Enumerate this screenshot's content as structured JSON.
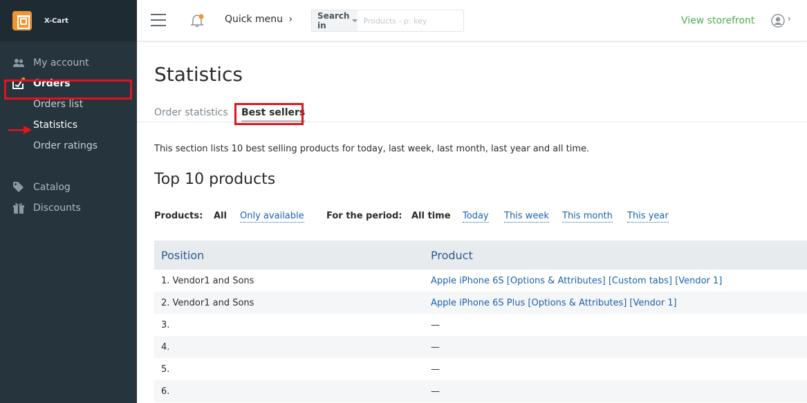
{
  "brand": {
    "name": "X-Cart"
  },
  "sidebar": {
    "items": [
      {
        "label": "My account",
        "icon": "users-icon"
      },
      {
        "label": "Orders",
        "icon": "orders-icon",
        "active": true
      },
      {
        "label": "Catalog",
        "icon": "tag-icon"
      },
      {
        "label": "Discounts",
        "icon": "gift-icon"
      }
    ],
    "orders_sub": [
      {
        "label": "Orders list"
      },
      {
        "label": "Statistics",
        "current": true
      },
      {
        "label": "Order ratings"
      }
    ]
  },
  "topbar": {
    "quick_menu": "Quick menu",
    "search_in": "Search in",
    "search_placeholder": "Products - p: key",
    "view_storefront": "View storefront"
  },
  "page": {
    "title": "Statistics",
    "tabs": [
      {
        "label": "Order statistics",
        "active": false
      },
      {
        "label": "Best sellers",
        "active": true
      }
    ],
    "description": "This section lists 10 best selling products for today, last week, last month, last year and all time.",
    "section_title": "Top 10 products"
  },
  "filters": {
    "products_label": "Products:",
    "products_current": "All",
    "products_other": "Only available",
    "period_label": "For the period:",
    "period_current": "All time",
    "period_links": [
      "Today",
      "This week",
      "This month",
      "This year"
    ]
  },
  "table": {
    "headers": [
      "Position",
      "Product"
    ],
    "rows": [
      {
        "position": "1. Vendor1 and Sons",
        "product": "Apple iPhone 6S [Options & Attributes] [Custom tabs] [Vendor 1]"
      },
      {
        "position": "2. Vendor1 and Sons",
        "product": "Apple iPhone 6S Plus [Options & Attributes] [Vendor 1]"
      },
      {
        "position": "3.",
        "product": "—"
      },
      {
        "position": "4.",
        "product": "—"
      },
      {
        "position": "5.",
        "product": "—"
      },
      {
        "position": "6.",
        "product": "—"
      }
    ]
  },
  "colors": {
    "sidebar_bg": "#26343d",
    "accent_orange": "#f39331",
    "link_blue": "#1a61b1",
    "storefront_green": "#4caf50",
    "highlight_red": "#e0141e"
  }
}
